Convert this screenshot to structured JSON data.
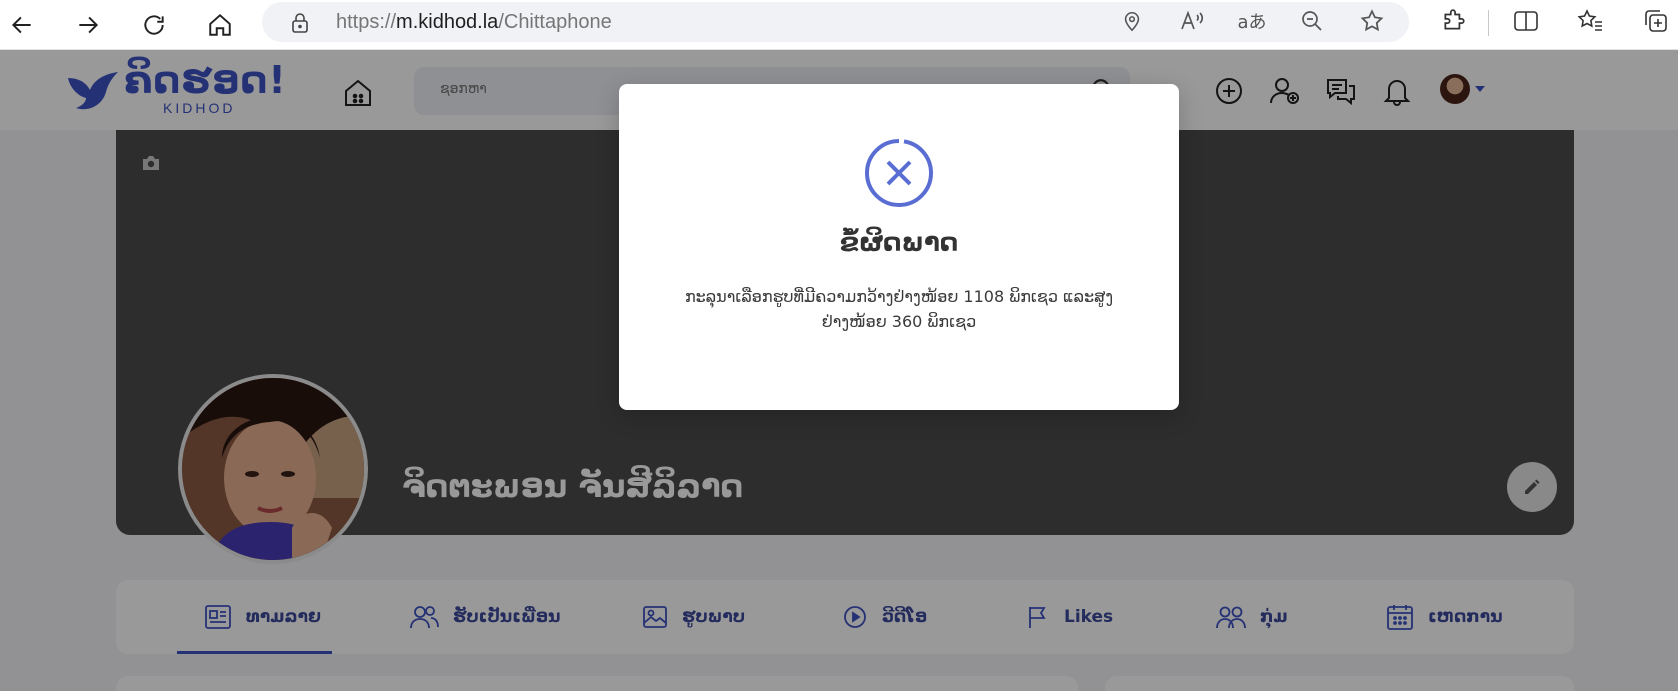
{
  "browser": {
    "url_scheme": "https://",
    "url_host": "m.kidhod.la",
    "url_path": "/Chittaphone"
  },
  "site": {
    "logo_text": "ຄິດຮອດ!",
    "logo_sub": "KIDHOD",
    "search_placeholder": "ຊອກຫາ"
  },
  "profile": {
    "name": "ຈິດຕະພອນ ຈັນສີລິລາດ"
  },
  "tabs": [
    {
      "label": "ທາມລາຍ",
      "icon": "timeline-icon"
    },
    {
      "label": "ຮັບເປັນເພື່ອນ",
      "icon": "friends-icon"
    },
    {
      "label": "ຮູບພາບ",
      "icon": "photos-icon"
    },
    {
      "label": "ວີດີໂອ",
      "icon": "video-icon"
    },
    {
      "label": "Likes",
      "icon": "flag-icon"
    },
    {
      "label": "ກຸ່ມ",
      "icon": "groups-icon"
    },
    {
      "label": "ເຫດການ",
      "icon": "calendar-icon"
    }
  ],
  "modal": {
    "title": "ຂໍ້ຜິດພາດ",
    "message": "ກະລຸນາເລືອກຮູບທີ່ມີຄວາມກວ້າງຢ່າງໜ້ອຍ 1108 ພິກເຊວ ແລະສູງຢ່າງໜ້ອຍ 360 ພິກເຊວ"
  },
  "colors": {
    "accent": "#3f53c4",
    "cover": "#4b4b4b",
    "overlay": "rgba(0,0,0,0.4)"
  }
}
